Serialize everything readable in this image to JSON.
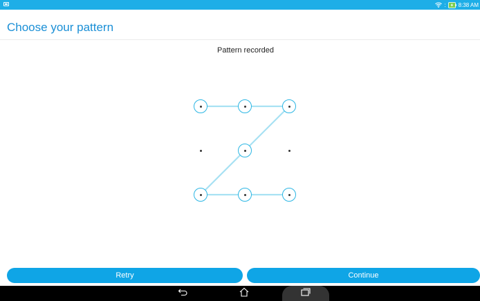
{
  "status_bar": {
    "time": "8:38 AM",
    "icons": [
      "app-notification-icon",
      "wifi-icon",
      "battery-charging-icon"
    ],
    "color": "#1eaee7"
  },
  "page": {
    "title": "Choose your pattern",
    "status_message": "Pattern recorded"
  },
  "pattern": {
    "grid_size": 3,
    "selected_dots": [
      0,
      1,
      2,
      4,
      6,
      7,
      8
    ],
    "path": [
      0,
      1,
      2,
      4,
      6,
      7,
      8
    ],
    "line_color": "#a7e1f3",
    "dot_color": "#2bb6e4"
  },
  "buttons": {
    "retry_label": "Retry",
    "continue_label": "Continue",
    "color": "#0fa5e6"
  },
  "nav_bar": {
    "icons": [
      "back-icon",
      "home-icon",
      "recent-apps-icon"
    ]
  }
}
